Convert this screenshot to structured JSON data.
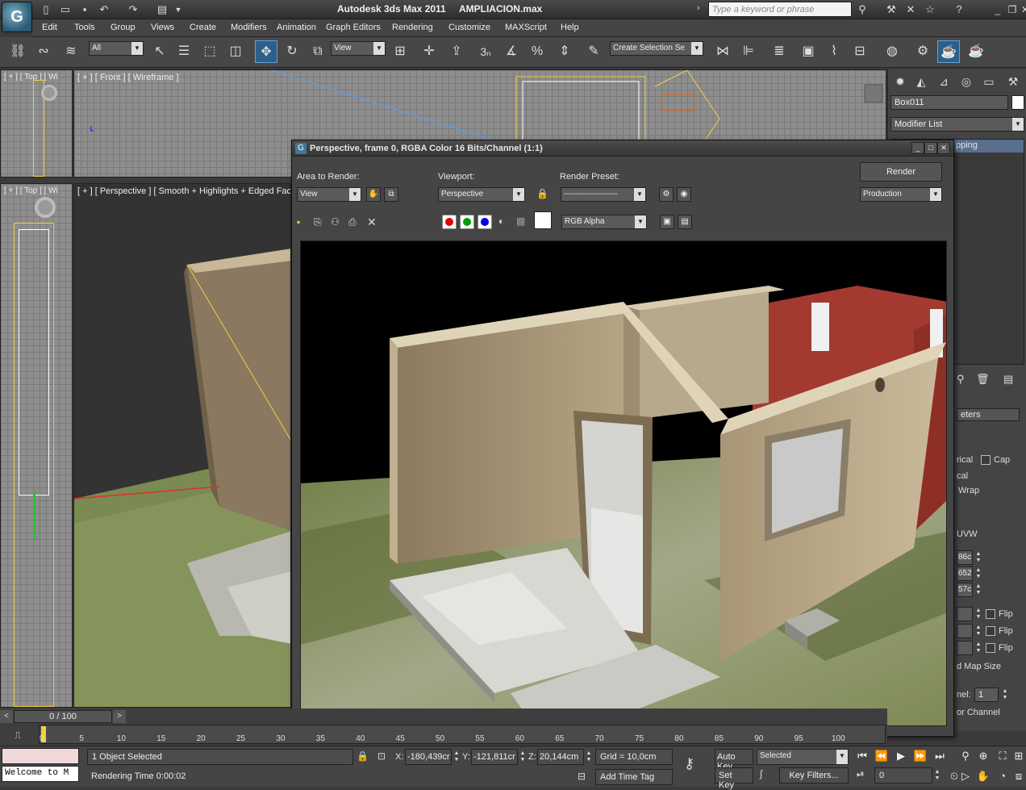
{
  "title_bar": {
    "app_name": "Autodesk 3ds Max  2011",
    "file_name": "AMPLIACION.max",
    "search_placeholder": "Type a keyword or phrase"
  },
  "menu": [
    "Edit",
    "Tools",
    "Group",
    "Views",
    "Create",
    "Modifiers",
    "Animation",
    "Graph Editors",
    "Rendering",
    "Customize",
    "MAXScript",
    "Help"
  ],
  "toolbar": {
    "selection_filter": "All",
    "reference_coord": "View",
    "named_selection": "Create Selection Se",
    "snap_label": "3"
  },
  "viewports": {
    "top_left_label": "[ + ] [ Top ] [ Wi",
    "front_label": "[ + ] [ Front ] [ Wireframe ]",
    "left_label": "[ + ] [ Top ] [ Wi",
    "perspective_label": "[ + ] [ Perspective ] [ Smooth + Highlights + Edged Faces ]"
  },
  "command_panel": {
    "object_name": "Box011",
    "modifier_list": "Modifier List",
    "modifier_item": "pping",
    "rollout_title": "eters",
    "radio_items": [
      "rical",
      "cal",
      "Wrap",
      "UVW"
    ],
    "cap_label": "Cap",
    "spinner_values": [
      "86c",
      "652",
      "57c"
    ],
    "flip_labels": [
      "Flip",
      "Flip",
      "Flip"
    ],
    "map_size_label": "d Map Size",
    "channel_label": "nel:",
    "channel_value": "1",
    "color_channel_label": "or Channel"
  },
  "render_window": {
    "title": "Perspective, frame 0, RGBA Color 16 Bits/Channel (1:1)",
    "area_to_render_label": "Area to Render:",
    "area_to_render_value": "View",
    "viewport_label": "Viewport:",
    "viewport_value": "Perspective",
    "render_preset_label": "Render Preset:",
    "render_preset_value": "--------------------",
    "render_button": "Render",
    "production_value": "Production",
    "channel_display": "RGB Alpha",
    "colors": {
      "red": "#e00000",
      "green": "#00a000",
      "blue": "#0000e0"
    }
  },
  "timeline": {
    "frame_counter": "0 / 100",
    "ticks": [
      "0",
      "5",
      "10",
      "15",
      "20",
      "25",
      "30",
      "35",
      "40",
      "45",
      "50",
      "55",
      "60",
      "65",
      "70",
      "75",
      "80",
      "85",
      "90",
      "95",
      "100"
    ]
  },
  "status_bar": {
    "maxscript_listener": "Welcome to M",
    "selection_status": "1 Object Selected",
    "render_time": "Rendering Time  0:00:02",
    "x_label": "X:",
    "x_value": "-180,439cr",
    "y_label": "Y:",
    "y_value": "-121,811cr",
    "z_label": "Z:",
    "z_value": "20,144cm",
    "grid": "Grid = 10,0cm",
    "add_time_tag": "Add Time Tag",
    "auto_key": "Auto Key",
    "set_key": "Set Key",
    "selected_dropdown": "Selected",
    "key_filters": "Key Filters...",
    "current_frame": "0"
  }
}
